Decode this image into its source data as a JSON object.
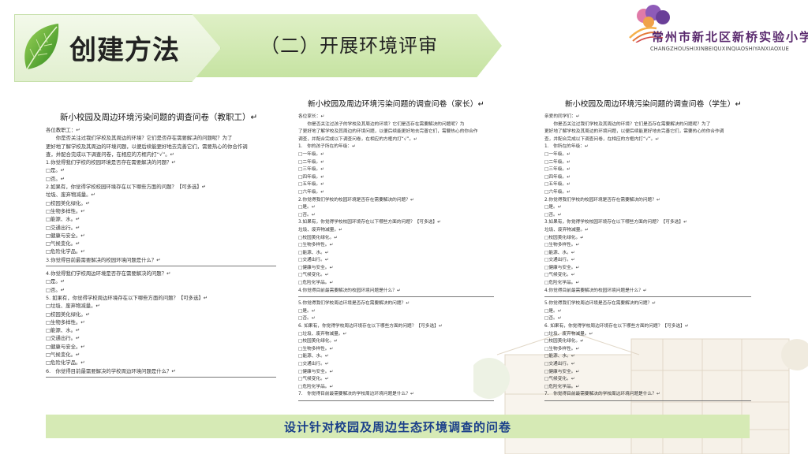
{
  "header": {
    "section_title": "创建方法",
    "subtitle": "（二）开展环境评审"
  },
  "logo": {
    "name_cn": "常州市新北区新桥实验小学",
    "name_en": "CHANGZHOUSHIXINBEIQUXINQIAOSHIYANXIAOXUE"
  },
  "questionnaires": [
    {
      "title": "新小校园及周边环境污染问题的调查问卷（教职工）↵",
      "lines": [
        "各位教职工：↵",
        "　　你是否关注过我们学校及其周边的环境？它们是否存在需要解决的问题呢？为了",
        "更好地了解学校及其周边的环境问题，以便后续能更好地去完善它们，需要热心的你合作调",
        "查，并配合完成以下调查问卷，在相应的方框内打“√”。↵",
        "1.你觉得我们学校的校园环境是否存在需要解决的问题？↵",
        "□是。↵",
        "□否。↵",
        "2.如果有，你觉得学校校园环境存在以下哪些方面的问题？【可多选】↵",
        "垃圾、废弃物减量。↵",
        "□校园美化绿化。↵",
        "□生物多样性。↵",
        "□能源、水。↵",
        "□交通出行。↵",
        "□健康与安全。↵",
        "□气候变化。↵",
        "□危险化学品。↵",
        "3.你觉得目前最需要解决的校园环境问题是什么？↵",
        "RULE",
        "4.你觉得我们学校周边环境是否存在需要解决的问题？↵",
        "□是。↵",
        "□否。↵",
        "5. 如果有，你觉得学校周边环境存在以下哪些方面的问题？【可多选】↵",
        "□垃圾、废弃物减量。↵",
        "□校园美化绿化。↵",
        "□生物多样性。↵",
        "□能源、水。↵",
        "□交通出行。↵",
        "□健康与安全。↵",
        "□气候变化。↵",
        "□危险化学品。↵",
        "6.　你觉得目前最需要解决的学校周边环境问题是什么？↵",
        "RULE"
      ]
    },
    {
      "title": "新小校园及周边环境污染问题的调查问卷（家长）↵",
      "lines": [
        "各位家长：↵",
        "　　你是否关注过孩子的学校及其周边的环境？它们是否存在需要解决的问题呢？为",
        "了更好地了解学校及其周边的环境问题，以便后续能更好地去完善它们，需要热心的你合作",
        "调查，并配合完成以下调查问卷，在相应的方框内打“√”。↵",
        "1.　你的孩子所在的年级：↵",
        "□一年级。↵",
        "□二年级。↵",
        "□三年级。↵",
        "□四年级。↵",
        "□五年级。↵",
        "□六年级。↵",
        "2.你觉得我们学校的校园环境是否存在需要解决的问题？↵",
        "□是。↵",
        "□否。↵",
        "3.如果有，你觉得学校校园环境存在以下哪些方面的问题？【可多选】↵",
        "垃圾、废弃物减量。↵",
        "□校园美化绿化。↵",
        "□生物多样性。↵",
        "□能源、水。↵",
        "□交通出行。↵",
        "□健康与安全。↵",
        "□气候变化。↵",
        "□危险化学品。↵",
        "4.你觉得目前最需要解决的校园环境问题是什么？↵",
        "RULE",
        "5.你觉得我们学校周边环境是否存在需要解决的问题？↵",
        "□是。↵",
        "□否。↵",
        "6. 如果有，你觉得学校周边环境存在以下哪些方面的问题？【可多选】↵",
        "□垃圾、废弃物减量。↵",
        "□校园美化绿化。↵",
        "□生物多样性。↵",
        "□能源、水。↵",
        "□交通出行。↵",
        "□健康与安全。↵",
        "□气候变化。↵",
        "□危险化学品。↵",
        "7.　你觉得目前最需要解决的学校周边环境问题是什么？↵",
        "RULE"
      ]
    },
    {
      "title": "新小校园及周边环境污染问题的调查问卷（学生）↵",
      "lines": [
        "亲爱的同学们：↵",
        "　　你是否关注过我们学校及其周边的环境？它们是否存在需要解决的问题呢？为了",
        "更好地了解学校及其周边的环境问题，以便后续能更好地去完善它们，需要热心的你合作调",
        "查，并配合完成以下调查问卷，在相应的方框内打“√”。↵",
        "1.　你所在的年级：↵",
        "□一年级。↵",
        "□二年级。↵",
        "□三年级。↵",
        "□四年级。↵",
        "□五年级。↵",
        "□六年级。↵",
        "2.你觉得我们学校的校园环境是否存在需要解决的问题？↵",
        "□是。↵",
        "□否。↵",
        "3.如果有，你觉得学校校园环境存在以下哪些方面的问题？【可多选】↵",
        "垃圾、废弃物减量。↵",
        "□校园美化绿化。↵",
        "□生物多样性。↵",
        "□能源、水。↵",
        "□交通出行。↵",
        "□健康与安全。↵",
        "□气候变化。↵",
        "□危险化学品。↵",
        "4.你觉得目前最需要解决的校园环境问题是什么？↵",
        "RULE",
        "5.你觉得我们学校周边环境是否存在需要解决的问题？↵",
        "□是。↵",
        "□否。↵",
        "6. 如果有，你觉得学校周边环境存在以下哪些方面的问题？【可多选】↵",
        "□垃圾、废弃物减量。↵",
        "□校园美化绿化。↵",
        "□生物多样性。↵",
        "□能源、水。↵",
        "□交通出行。↵",
        "□健康与安全。↵",
        "□气候变化。↵",
        "□危险化学品。↵",
        "7.　你觉得目前最需要解决的学校周边环境问题是什么？↵",
        "RULE"
      ]
    }
  ],
  "caption": "设计针对校园及周边生态环境调查的问卷",
  "colors": {
    "banner_light": "#e1efcf",
    "banner_mid": "#c6e3a2",
    "caption_bg": "#d6eab5",
    "caption_text": "#1a3f8a",
    "logo_text": "#5a2a6e"
  }
}
